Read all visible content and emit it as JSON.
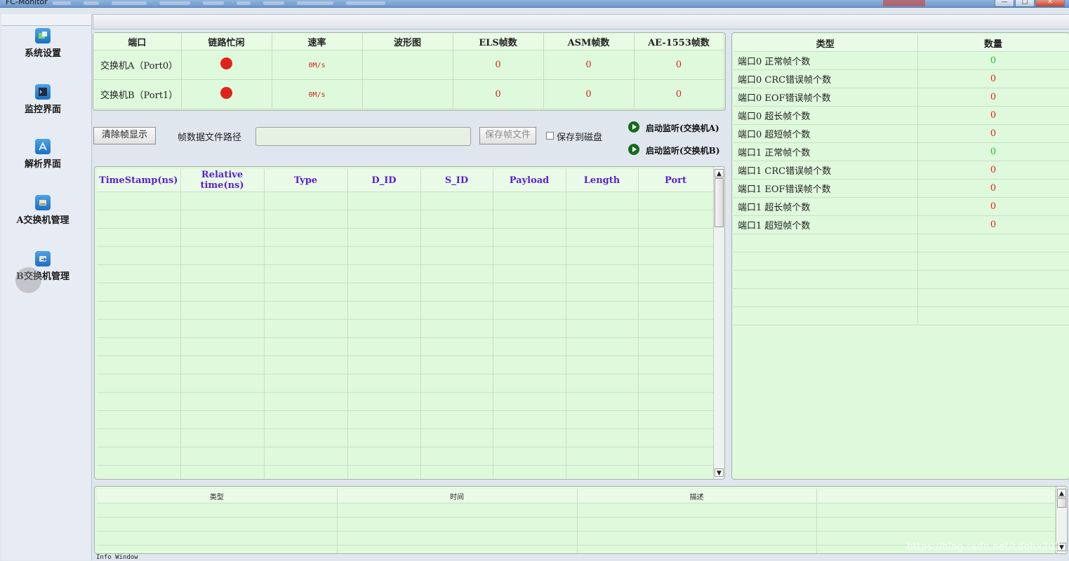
{
  "window": {
    "title": "FC-Monitor"
  },
  "sidebar": {
    "items": [
      {
        "label": "系统设置",
        "icon": "system-settings-icon"
      },
      {
        "label": "监控界面",
        "icon": "monitor-screen-icon"
      },
      {
        "label": "解析界面",
        "icon": "parse-icon"
      },
      {
        "label": "A交换机管理",
        "icon": "switch-a-icon"
      },
      {
        "label": "B交换机管理",
        "icon": "switch-b-icon"
      }
    ]
  },
  "ports": {
    "headers": [
      "端口",
      "链路忙闲",
      "速率",
      "波形图",
      "ELS帧数",
      "ASM帧数",
      "AE-1553帧数"
    ],
    "rows": [
      {
        "name": "交换机A（Port0）",
        "rate": "0M/s",
        "els": "0",
        "asm": "0",
        "ae1553": "0"
      },
      {
        "name": "交换机B（Port1）",
        "rate": "0M/s",
        "els": "0",
        "asm": "0",
        "ae1553": "0"
      }
    ]
  },
  "controls": {
    "clear_label": "清除帧显示",
    "path_label": "帧数据文件路径",
    "path_value": "",
    "save_label": "保存帧文件",
    "save_disk_label": "保存到磁盘",
    "monitor_a_label": "启动监听(交换机A)",
    "monitor_b_label": "启动监听(交换机B)"
  },
  "frames": {
    "headers": [
      "TimeStamp(ns)",
      "Relative time(ns)",
      "Type",
      "D_ID",
      "S_ID",
      "Payload",
      "Length",
      "Port"
    ]
  },
  "stats": {
    "headers": [
      "类型",
      "数量"
    ],
    "rows": [
      {
        "type": "端口0 正常帧个数",
        "value": "0",
        "color": "#22c23a"
      },
      {
        "type": "端口0 CRC错误帧个数",
        "value": "0",
        "color": "#e0241b"
      },
      {
        "type": "端口0 EOF错误帧个数",
        "value": "0",
        "color": "#e0241b"
      },
      {
        "type": "端口0 超长帧个数",
        "value": "0",
        "color": "#e0241b"
      },
      {
        "type": "端口0 超短帧个数",
        "value": "0",
        "color": "#e0241b"
      },
      {
        "type": "端口1 正常帧个数",
        "value": "0",
        "color": "#22c23a"
      },
      {
        "type": "端口1 CRC错误帧个数",
        "value": "0",
        "color": "#e0241b"
      },
      {
        "type": "端口1 EOF错误帧个数",
        "value": "0",
        "color": "#e0241b"
      },
      {
        "type": "端口1 超长帧个数",
        "value": "0",
        "color": "#e0241b"
      },
      {
        "type": "端口1 超短帧个数",
        "value": "0",
        "color": "#e0241b"
      }
    ]
  },
  "info": {
    "headers": [
      "类型",
      "时间",
      "描述",
      ""
    ],
    "window_label": "Info Window"
  },
  "watermark": "https://blog.csdn.net/cdqhx202"
}
